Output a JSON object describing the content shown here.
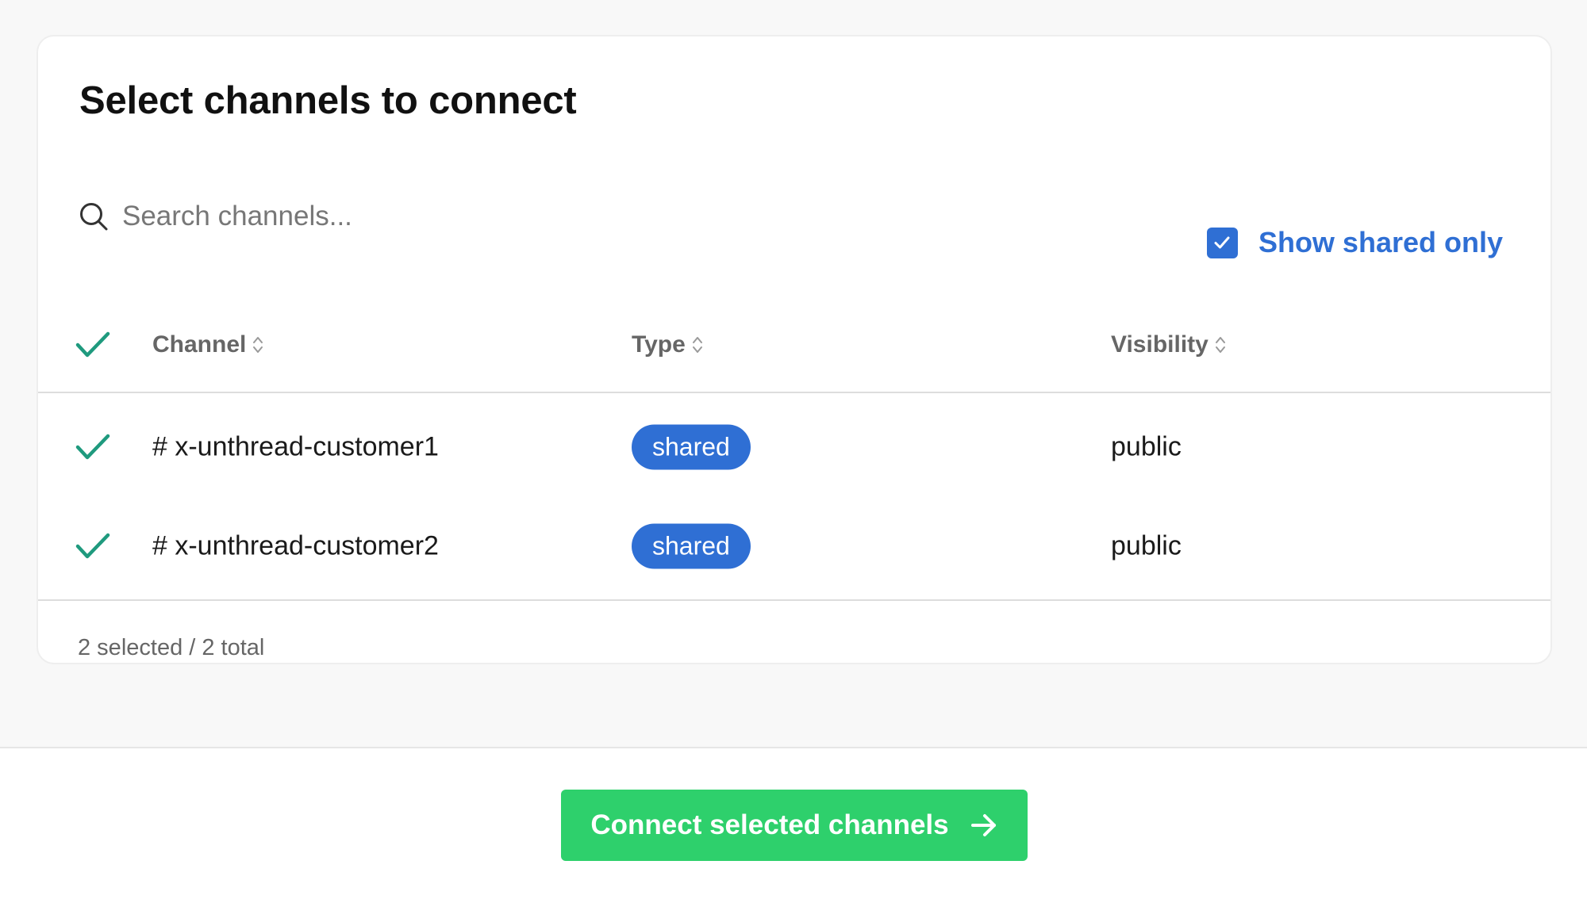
{
  "title": "Select channels to connect",
  "search": {
    "placeholder": "Search channels...",
    "value": "",
    "icon": "search-icon"
  },
  "filter": {
    "label": "Show shared only",
    "checked": true,
    "color": "#2f6fd4"
  },
  "table": {
    "header_select_all_checked": true,
    "columns": [
      {
        "label": "Channel",
        "sortable": true
      },
      {
        "label": "Type",
        "sortable": true
      },
      {
        "label": "Visibility",
        "sortable": true
      }
    ],
    "rows": [
      {
        "selected": true,
        "channel": "# x-unthread-customer1",
        "type": "shared",
        "visibility": "public"
      },
      {
        "selected": true,
        "channel": "# x-unthread-customer2",
        "type": "shared",
        "visibility": "public"
      }
    ]
  },
  "summary": "2 selected / 2 total",
  "footer": {
    "button_label": "Connect selected channels",
    "button_icon": "arrow-right-icon"
  },
  "colors": {
    "accent": "#2f6fd4",
    "check": "#1f9a7e",
    "primary_button": "#2ed06c"
  }
}
